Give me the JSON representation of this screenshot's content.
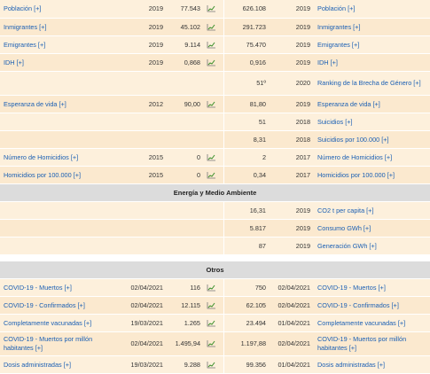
{
  "rows": [
    {
      "left_label": "Población [+]",
      "left_year": "2019",
      "left_value": "77.543",
      "right_value": "626.108",
      "right_year": "2019",
      "right_label": "Población [+]"
    },
    {
      "left_label": "Inmigrantes [+]",
      "left_year": "2019",
      "left_value": "45.102",
      "right_value": "291.723",
      "right_year": "2019",
      "right_label": "Inmigrantes [+]"
    },
    {
      "left_label": "Emigrantes [+]",
      "left_year": "2019",
      "left_value": "9.114",
      "right_value": "75.470",
      "right_year": "2019",
      "right_label": "Emigrantes [+]"
    },
    {
      "left_label": "IDH [+]",
      "left_year": "2019",
      "left_value": "0,868",
      "right_value": "0,916",
      "right_year": "2019",
      "right_label": "IDH [+]"
    },
    {
      "right_value": "51º",
      "right_year": "2020",
      "right_label": "Ranking de la Brecha de Género [+]"
    },
    {
      "left_label": "Esperanza de vida [+]",
      "left_year": "2012",
      "left_value": "90,00",
      "right_value": "81,80",
      "right_year": "2019",
      "right_label": "Esperanza de vida [+]"
    },
    {
      "right_value": "51",
      "right_year": "2018",
      "right_label": "Suicidios [+]"
    },
    {
      "right_value": "8,31",
      "right_year": "2018",
      "right_label": "Suicidios por 100.000 [+]"
    },
    {
      "left_label": "Número de Homicidios [+]",
      "left_year": "2015",
      "left_value": "0",
      "right_value": "2",
      "right_year": "2017",
      "right_label": "Número de Homicidios [+]"
    },
    {
      "left_label": "Homicidios por 100.000 [+]",
      "left_year": "2015",
      "left_value": "0",
      "right_value": "0,34",
      "right_year": "2017",
      "right_label": "Homicidios por 100.000 [+]"
    }
  ],
  "section_energy": "Energía y Medio Ambiente",
  "energy_rows": [
    {
      "right_value": "16,31",
      "right_year": "2019",
      "right_label": "CO2 t per capita [+]"
    },
    {
      "right_value": "5.817",
      "right_year": "2019",
      "right_label": "Consumo GWh [+]"
    },
    {
      "right_value": "87",
      "right_year": "2019",
      "right_label": "Generación GWh [+]"
    }
  ],
  "section_others": "Otros",
  "other_rows": [
    {
      "left_label": "COVID-19 - Muertos [+]",
      "left_year": "02/04/2021",
      "left_value": "116",
      "right_value": "750",
      "right_year": "02/04/2021",
      "right_label": "COVID-19 - Muertos [+]"
    },
    {
      "left_label": "COVID-19 - Confirmados [+]",
      "left_year": "02/04/2021",
      "left_value": "12.115",
      "right_value": "62.105",
      "right_year": "02/04/2021",
      "right_label": "COVID-19 - Confirmados [+]"
    },
    {
      "left_label": "Completamente vacunadas [+]",
      "left_year": "19/03/2021",
      "left_value": "1.265",
      "right_value": "23.494",
      "right_year": "01/04/2021",
      "right_label": "Completamente vacunadas [+]"
    },
    {
      "left_label": "COVID-19 - Muertos por millón habitantes [+]",
      "left_year": "02/04/2021",
      "left_value": "1.495,94",
      "right_value": "1.197,88",
      "right_year": "02/04/2021",
      "right_label": "COVID-19 - Muertos por millón habitantes [+]"
    },
    {
      "left_label": "Dosis administradas [+]",
      "left_year": "19/03/2021",
      "left_value": "9.288",
      "right_value": "99.356",
      "right_year": "01/04/2021",
      "right_label": "Dosis administradas [+]"
    }
  ],
  "icons": {
    "chart_icon": "line-chart-icon"
  },
  "colors": {
    "link": "#1a5fb4",
    "row_bg": "#fdf0dc",
    "section_bg": "#dcdcdc",
    "chart_line": "#3a8f2a"
  }
}
